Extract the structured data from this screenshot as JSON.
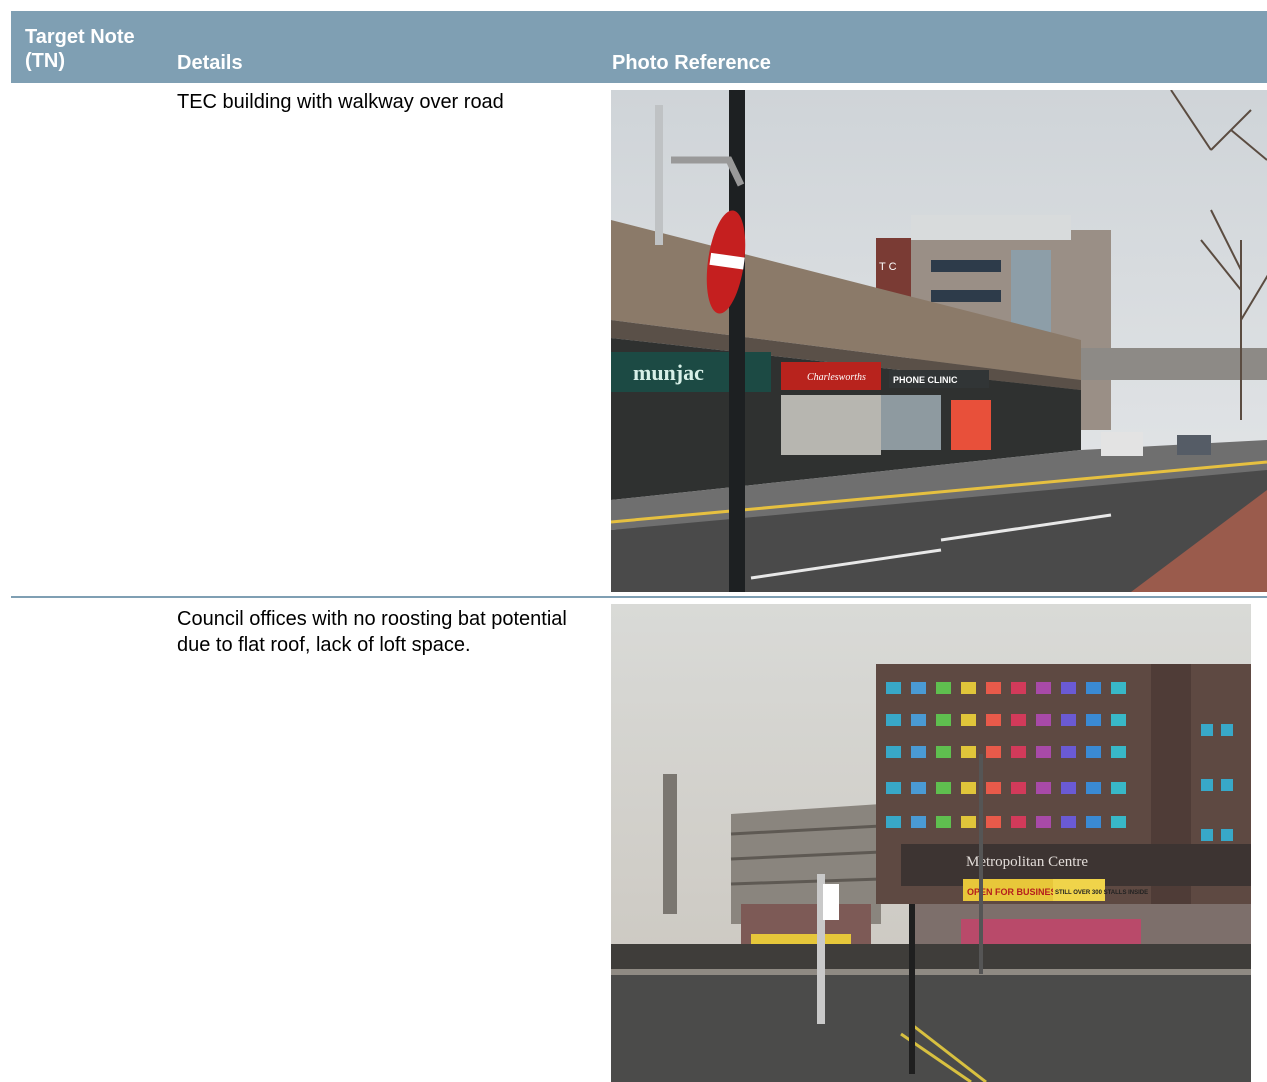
{
  "header": {
    "col_tn": "Target Note (TN)",
    "col_details": "Details",
    "col_photo": "Photo Reference"
  },
  "rows": [
    {
      "tn": "",
      "details": "TEC building with walkway over road",
      "photo": {
        "sign_tec": "T C",
        "shop_1": "munjac",
        "shop_2": "Charlesworths",
        "shop_3": "PHONE CLINIC"
      }
    },
    {
      "tn": "",
      "details": "Council offices with no roosting bat potential due to flat roof, lack of loft space.",
      "photo": {
        "building_sign": "Metropolitan Centre",
        "banner_1": "OPEN FOR BUSINESS",
        "banner_2": "STILL OVER 300 STALLS INSIDE"
      }
    }
  ]
}
